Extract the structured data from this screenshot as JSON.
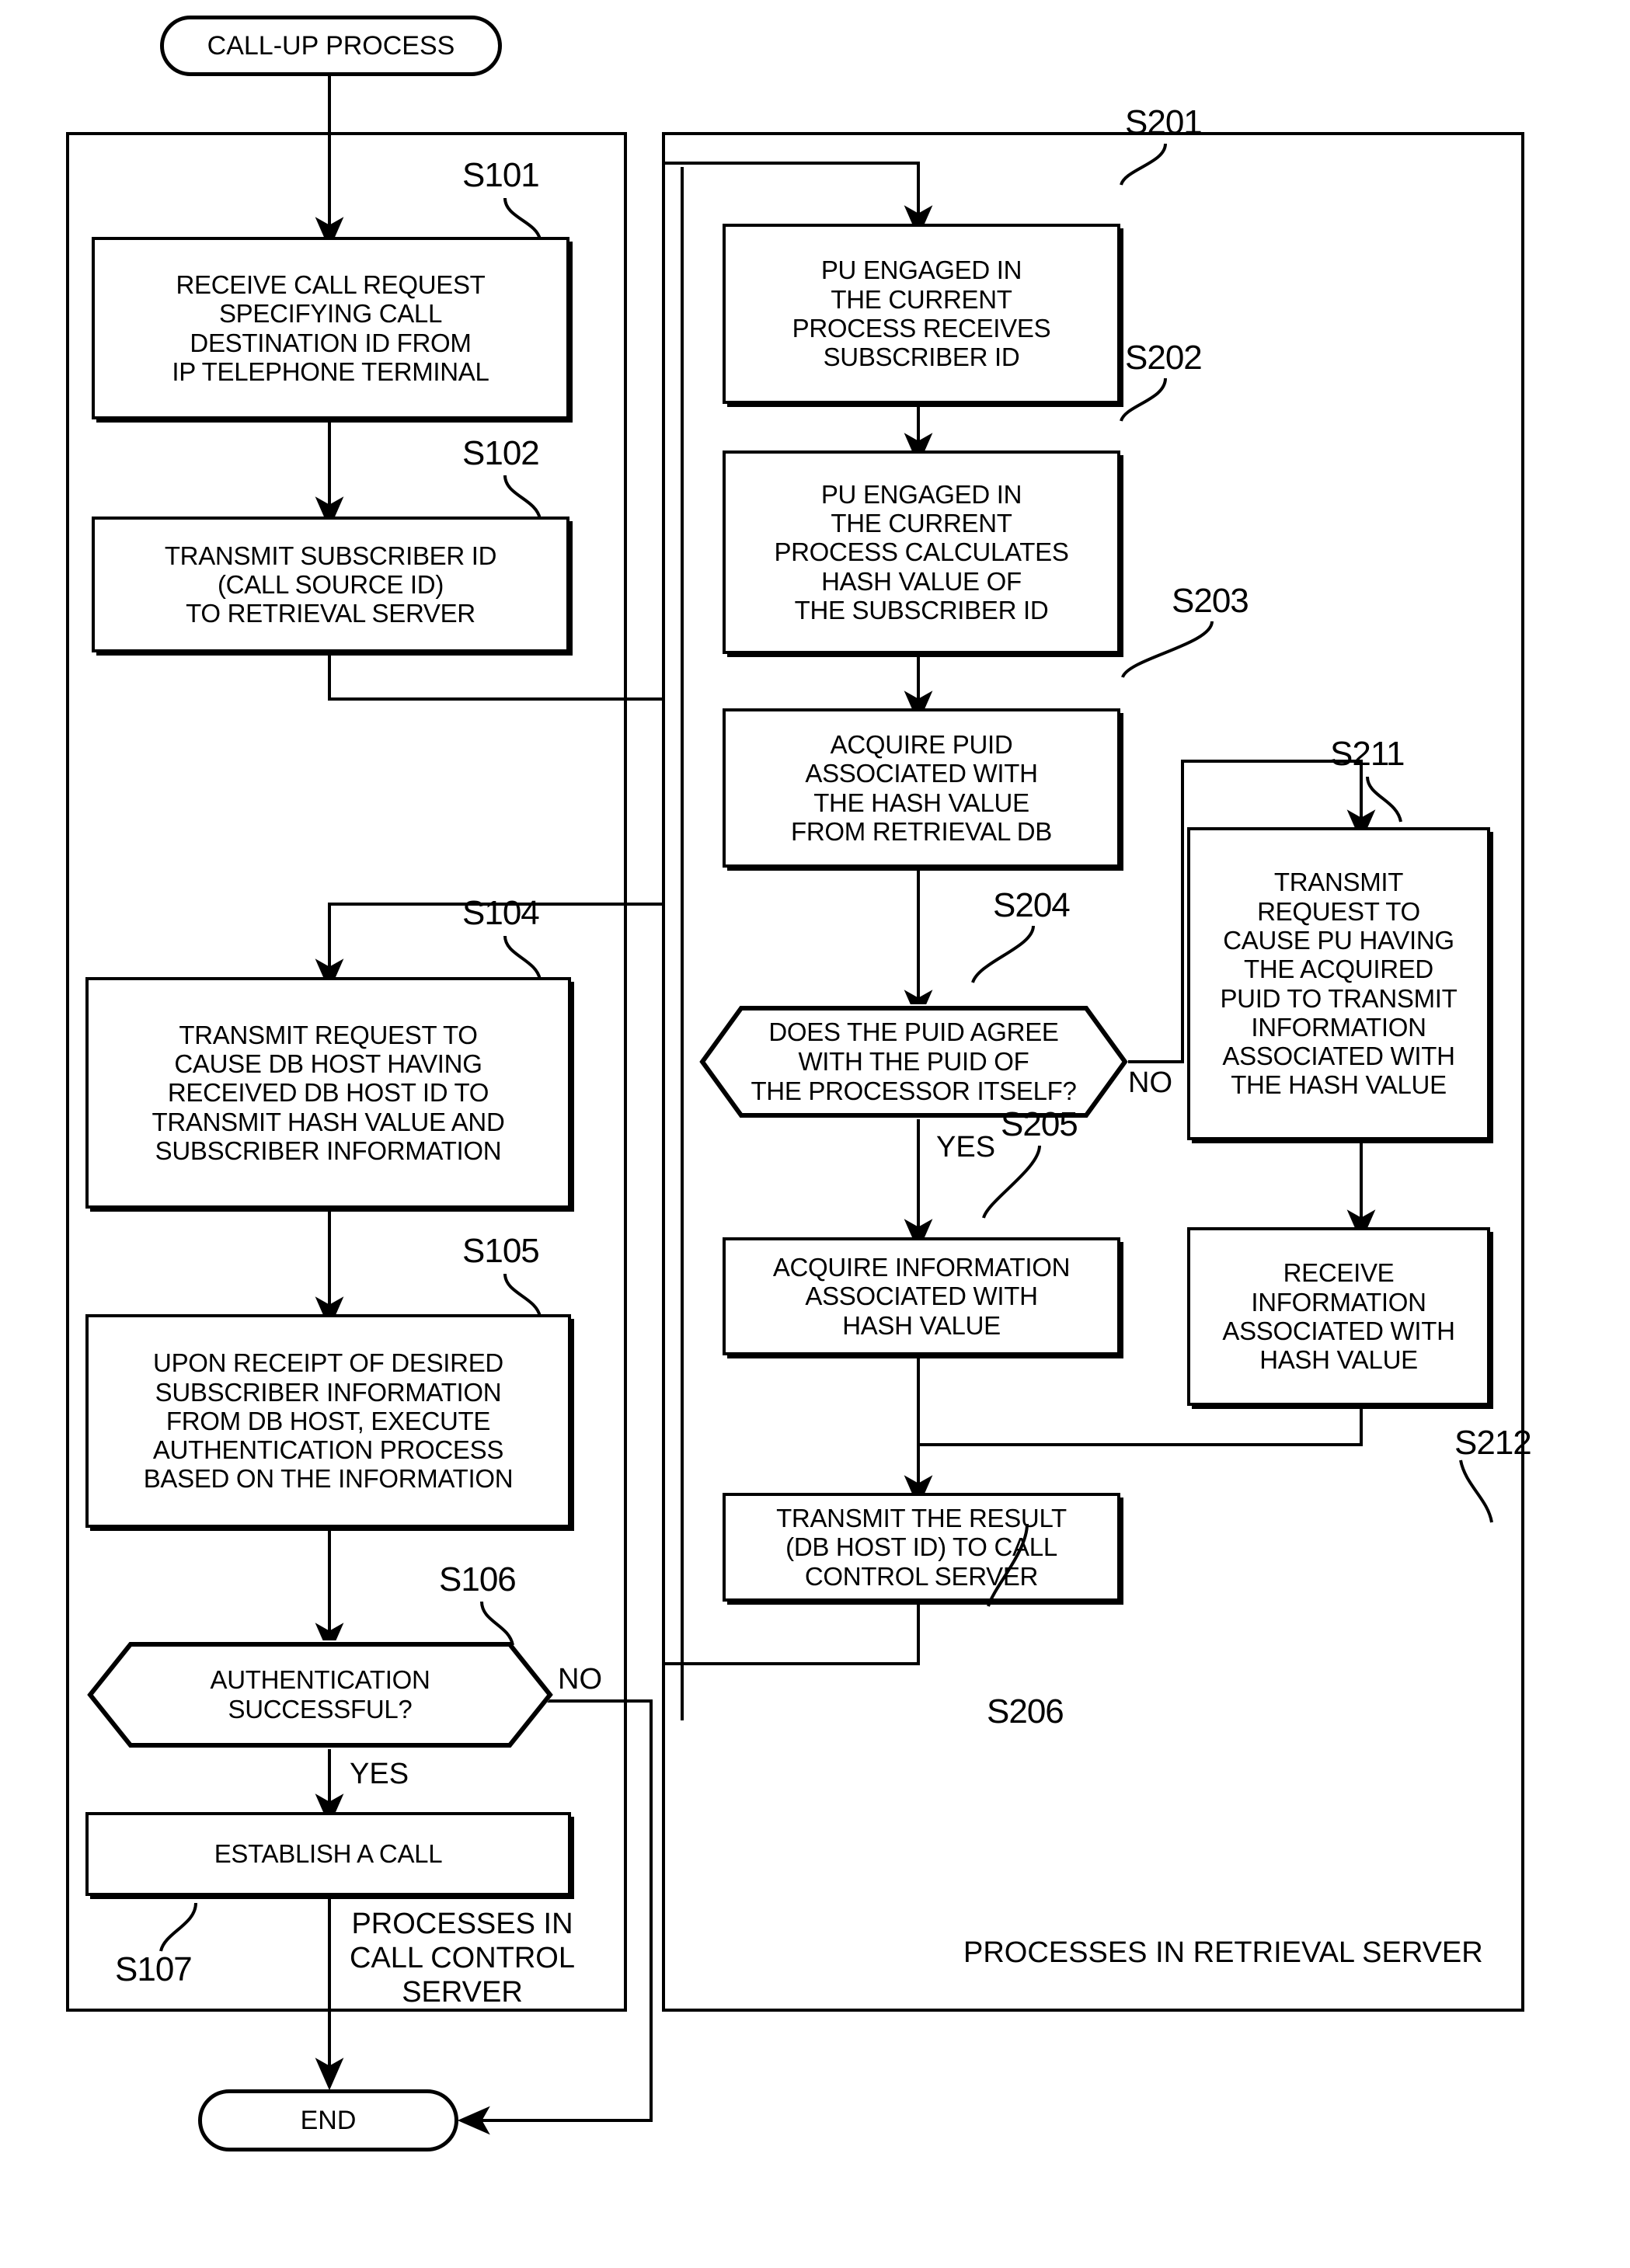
{
  "diagram": {
    "title": "CALL-UP PROCESS",
    "end_label": "END",
    "group_left_caption": "PROCESSES IN\nCALL CONTROL\nSERVER",
    "group_right_caption": "PROCESSES IN RETRIEVAL SERVER"
  },
  "nodes": {
    "start": {
      "label": "CALL-UP PROCESS"
    },
    "end": {
      "label": "END"
    },
    "s101": {
      "tag": "S101",
      "text": "RECEIVE CALL REQUEST\nSPECIFYING CALL\nDESTINATION ID FROM\nIP TELEPHONE TERMINAL"
    },
    "s102": {
      "tag": "S102",
      "text": "TRANSMIT SUBSCRIBER ID\n(CALL SOURCE ID)\nTO RETRIEVAL SERVER"
    },
    "s104": {
      "tag": "S104",
      "text": "TRANSMIT REQUEST TO\nCAUSE DB HOST HAVING\nRECEIVED DB HOST ID TO\nTRANSMIT HASH VALUE AND\nSUBSCRIBER INFORMATION"
    },
    "s105": {
      "tag": "S105",
      "text": "UPON RECEIPT OF DESIRED\nSUBSCRIBER INFORMATION\nFROM DB HOST, EXECUTE\nAUTHENTICATION PROCESS\nBASED ON THE INFORMATION"
    },
    "s106": {
      "tag": "S106",
      "text": "AUTHENTICATION\nSUCCESSFUL?",
      "yes": "YES",
      "no": "NO"
    },
    "s107": {
      "tag": "S107",
      "text": "ESTABLISH A CALL"
    },
    "s201": {
      "tag": "S201",
      "text": "PU ENGAGED IN\nTHE CURRENT\nPROCESS RECEIVES\nSUBSCRIBER ID"
    },
    "s202": {
      "tag": "S202",
      "text": "PU ENGAGED IN\nTHE CURRENT\nPROCESS CALCULATES\nHASH VALUE OF\nTHE SUBSCRIBER ID"
    },
    "s203": {
      "tag": "S203",
      "text": "ACQUIRE PUID\nASSOCIATED WITH\nTHE HASH VALUE\nFROM RETRIEVAL DB"
    },
    "s204": {
      "tag": "S204",
      "text": "DOES THE PUID AGREE\nWITH THE PUID OF\nTHE PROCESSOR ITSELF?",
      "yes": "YES",
      "no": "NO"
    },
    "s205": {
      "tag": "S205",
      "text": "ACQUIRE INFORMATION\nASSOCIATED WITH\nHASH VALUE"
    },
    "s206": {
      "tag": "S206",
      "text": "TRANSMIT THE RESULT\n(DB HOST ID) TO CALL\nCONTROL SERVER"
    },
    "s211": {
      "tag": "S211",
      "text": "TRANSMIT\nREQUEST TO\nCAUSE PU HAVING\nTHE ACQUIRED\nPUID TO TRANSMIT\nINFORMATION\nASSOCIATED WITH\nTHE HASH VALUE"
    },
    "s212": {
      "tag": "S212",
      "text": "RECEIVE\nINFORMATION\nASSOCIATED WITH\nHASH VALUE"
    }
  },
  "colors": {
    "stroke": "#000000",
    "background": "#ffffff"
  }
}
